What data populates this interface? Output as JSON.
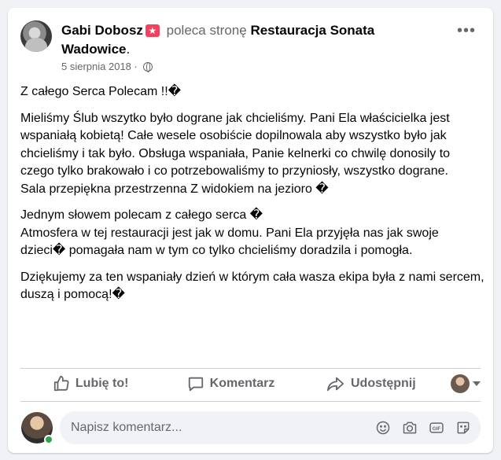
{
  "post": {
    "author": "Gabi Dobosz",
    "badge_glyph": "★",
    "verb": "poleca stronę",
    "page_name": "Restauracja Sonata Wadowice",
    "page_suffix": ".",
    "date": "5 sierpnia 2018",
    "date_sep": "·",
    "more_glyph": "•••",
    "paragraphs": [
      "Z całego Serca Polecam !!�",
      "Mieliśmy Ślub wszytko było dograne jak chcieliśmy. Pani Ela właścicielka jest wspaniałą kobietą! Całe wesele osobiście dopilnowala aby wszystko było jak chcieliśmy i tak było. Obsługa wspaniała, Panie kelnerki co chwilę donosily to czego tylko brakowało i co potrzebowaliśmy to przyniosły, wszystko dograne.\nSala przepiękna przestrzenna Z widokiem na jezioro �",
      "Jednym słowem polecam z całego serca �\nAtmosfera w tej restauracji jest jak w domu. Pani Ela przyjęła nas jak swoje dzieci� pomagała nam w tym co tylko chcieliśmy doradzila i pomogła.",
      "Dziękujemy za ten wspaniały dzień  w którym  cała wasza ekipa była z nami sercem, duszą i pomocą!�"
    ]
  },
  "actions": {
    "like": "Lubię to!",
    "comment": "Komentarz",
    "share": "Udostępnij"
  },
  "comment": {
    "placeholder": "Napisz komentarz..."
  },
  "icons": {
    "like": "thumbs-up-icon",
    "comment": "speech-bubble-icon",
    "share": "share-arrow-icon",
    "privacy": "globe-icon",
    "emoji": "emoji-icon",
    "camera": "camera-icon",
    "gif": "gif-icon",
    "sticker": "sticker-icon"
  },
  "colors": {
    "text": "#050505",
    "secondary": "#65676b",
    "badge": "#f3425f",
    "online": "#31a24c"
  }
}
